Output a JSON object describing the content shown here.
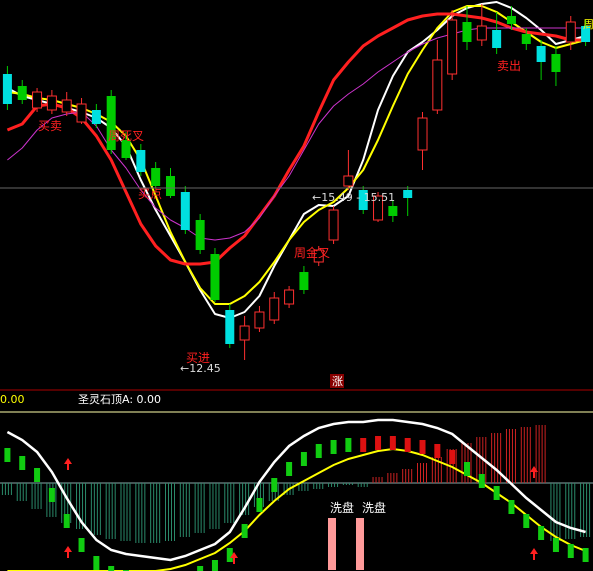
{
  "chart_data": [
    {
      "type": "candlestick",
      "title": "",
      "ma_lines": [
        {
          "color": "#ffffff",
          "values": [
            88,
            96,
            100,
            104,
            108,
            112,
            118,
            128,
            146,
            180,
            210,
            236,
            262,
            290,
            314,
            318,
            312,
            296,
            266,
            240,
            214,
            205,
            206,
            196,
            160,
            110,
            76,
            52,
            42,
            30,
            16,
            8,
            4,
            2,
            8,
            18,
            30,
            44,
            40,
            36
          ]
        },
        {
          "color": "#ffff00",
          "values": [
            92,
            94,
            98,
            100,
            104,
            108,
            114,
            122,
            136,
            160,
            196,
            232,
            262,
            288,
            304,
            304,
            296,
            282,
            262,
            240,
            222,
            210,
            202,
            188,
            170,
            140,
            106,
            74,
            50,
            28,
            12,
            6,
            6,
            12,
            22,
            32,
            42,
            48,
            44,
            40
          ]
        },
        {
          "color": "#ff2020",
          "values": [
            130,
            124,
            106,
            104,
            108,
            118,
            136,
            160,
            192,
            224,
            246,
            260,
            264,
            264,
            262,
            248,
            236,
            216,
            196,
            170,
            146,
            112,
            80,
            62,
            46,
            36,
            28,
            20,
            16,
            14,
            14,
            16,
            18,
            22,
            28,
            32,
            34,
            36,
            40,
            40
          ]
        },
        {
          "color": "#cc33cc",
          "values": [
            160,
            148,
            130,
            118,
            114,
            112,
            126,
            150,
            168,
            190,
            208,
            220,
            228,
            238,
            240,
            238,
            232,
            218,
            196,
            176,
            150,
            124,
            106,
            94,
            84,
            72,
            62,
            52,
            44,
            38,
            34,
            30,
            28,
            28,
            28,
            28,
            28,
            28,
            28,
            28
          ]
        }
      ],
      "candles": [
        {
          "o": 74,
          "c": 104,
          "h": 66,
          "l": 110,
          "up": false
        },
        {
          "o": 86,
          "c": 100,
          "h": 80,
          "l": 104,
          "up": false
        },
        {
          "o": 92,
          "c": 108,
          "h": 88,
          "l": 112,
          "up": true
        },
        {
          "o": 96,
          "c": 110,
          "h": 90,
          "l": 114,
          "up": true
        },
        {
          "o": 100,
          "c": 112,
          "h": 92,
          "l": 116,
          "up": true
        },
        {
          "o": 104,
          "c": 122,
          "h": 98,
          "l": 124,
          "up": true
        },
        {
          "o": 110,
          "c": 124,
          "h": 104,
          "l": 128,
          "up": false
        },
        {
          "o": 96,
          "c": 150,
          "h": 90,
          "l": 154,
          "up": false
        },
        {
          "o": 140,
          "c": 158,
          "h": 132,
          "l": 160,
          "up": false
        },
        {
          "o": 150,
          "c": 172,
          "h": 144,
          "l": 176,
          "up": false
        },
        {
          "o": 168,
          "c": 186,
          "h": 162,
          "l": 188,
          "up": false
        },
        {
          "o": 176,
          "c": 196,
          "h": 168,
          "l": 198,
          "up": false
        },
        {
          "o": 192,
          "c": 230,
          "h": 186,
          "l": 234,
          "up": false
        },
        {
          "o": 220,
          "c": 250,
          "h": 214,
          "l": 254,
          "up": false
        },
        {
          "o": 254,
          "c": 300,
          "h": 248,
          "l": 302,
          "up": false
        },
        {
          "o": 310,
          "c": 344,
          "h": 304,
          "l": 348,
          "up": false
        },
        {
          "o": 326,
          "c": 340,
          "h": 316,
          "l": 360,
          "up": true
        },
        {
          "o": 312,
          "c": 328,
          "h": 306,
          "l": 332,
          "up": true
        },
        {
          "o": 298,
          "c": 320,
          "h": 292,
          "l": 324,
          "up": true
        },
        {
          "o": 290,
          "c": 304,
          "h": 286,
          "l": 308,
          "up": true
        },
        {
          "o": 272,
          "c": 290,
          "h": 266,
          "l": 294,
          "up": false
        },
        {
          "o": 250,
          "c": 262,
          "h": 246,
          "l": 266,
          "up": true
        },
        {
          "o": 210,
          "c": 240,
          "h": 206,
          "l": 244,
          "up": true
        },
        {
          "o": 176,
          "c": 186,
          "h": 150,
          "l": 190,
          "up": true
        },
        {
          "o": 190,
          "c": 210,
          "h": 186,
          "l": 214,
          "up": false
        },
        {
          "o": 196,
          "c": 220,
          "h": 192,
          "l": 222,
          "up": true
        },
        {
          "o": 206,
          "c": 216,
          "h": 200,
          "l": 222,
          "up": false
        },
        {
          "o": 190,
          "c": 198,
          "h": 186,
          "l": 216,
          "up": false
        },
        {
          "o": 118,
          "c": 150,
          "h": 112,
          "l": 170,
          "up": true
        },
        {
          "o": 60,
          "c": 110,
          "h": 40,
          "l": 114,
          "up": true
        },
        {
          "o": 20,
          "c": 74,
          "h": 10,
          "l": 80,
          "up": true
        },
        {
          "o": 22,
          "c": 42,
          "h": 6,
          "l": 50,
          "up": false
        },
        {
          "o": 26,
          "c": 40,
          "h": 4,
          "l": 46,
          "up": true
        },
        {
          "o": 30,
          "c": 48,
          "h": 12,
          "l": 54,
          "up": false
        },
        {
          "o": 16,
          "c": 24,
          "h": 6,
          "l": 30,
          "up": false
        },
        {
          "o": 34,
          "c": 44,
          "h": 28,
          "l": 50,
          "up": false
        },
        {
          "o": 46,
          "c": 62,
          "h": 40,
          "l": 80,
          "up": false
        },
        {
          "o": 54,
          "c": 72,
          "h": 46,
          "l": 86,
          "up": false
        },
        {
          "o": 22,
          "c": 42,
          "h": 16,
          "l": 50,
          "up": true
        },
        {
          "o": 26,
          "c": 42,
          "h": 20,
          "l": 46,
          "up": false
        }
      ],
      "annotations": [
        {
          "text": "买卖",
          "color": "#ff2020"
        },
        {
          "text": "周死叉",
          "color": "#ff2020"
        },
        {
          "text": "买点",
          "color": "#ff2020"
        },
        {
          "text": "周金叉",
          "color": "#ff2020"
        },
        {
          "text": "买进",
          "color": "#ff2020"
        },
        {
          "text": "卖出",
          "color": "#ff2020"
        },
        {
          "text": "←12.45",
          "color": "#dddddd"
        },
        {
          "text": "←15.49 - 15.51",
          "color": "#dddddd"
        },
        {
          "text": "周",
          "color": "#ffff00"
        }
      ],
      "price_marks": [
        12.45,
        15.49,
        15.51
      ]
    },
    {
      "type": "indicator",
      "title": "圣灵石顶A: 0.00",
      "left_value": "0.00",
      "badge": "涨",
      "labels": [
        "洗盘",
        "洗盘"
      ],
      "white_line": [
        20,
        28,
        40,
        60,
        86,
        110,
        128,
        138,
        142,
        144,
        146,
        148,
        144,
        138,
        132,
        120,
        96,
        70,
        50,
        34,
        24,
        16,
        12,
        10,
        10,
        8,
        8,
        10,
        12,
        16,
        22,
        34,
        46,
        58,
        72,
        86,
        98,
        110,
        116,
        120
      ],
      "yellow_line": [
        0,
        0,
        0,
        0,
        0,
        0,
        0,
        0,
        0,
        0,
        0,
        2,
        6,
        12,
        18,
        28,
        40,
        56,
        70,
        82,
        90,
        98,
        106,
        112,
        116,
        120,
        122,
        120,
        116,
        110,
        104,
        96,
        88,
        78,
        68,
        56,
        44,
        34,
        26,
        20
      ],
      "bars": [
        12,
        18,
        26,
        34,
        40,
        46,
        52,
        56,
        58,
        60,
        60,
        58,
        54,
        50,
        46,
        40,
        32,
        24,
        18,
        12,
        8,
        6,
        4,
        2,
        4,
        6,
        10,
        14,
        20,
        26,
        34,
        40,
        46,
        50,
        54,
        56,
        58,
        58,
        56,
        54
      ]
    }
  ]
}
